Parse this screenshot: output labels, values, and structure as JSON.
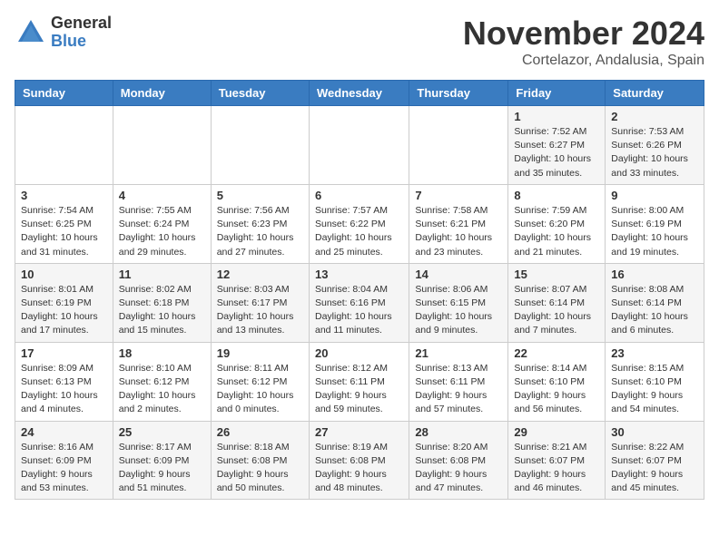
{
  "logo": {
    "general": "General",
    "blue": "Blue"
  },
  "title": "November 2024",
  "location": "Cortelazor, Andalusia, Spain",
  "days_of_week": [
    "Sunday",
    "Monday",
    "Tuesday",
    "Wednesday",
    "Thursday",
    "Friday",
    "Saturday"
  ],
  "weeks": [
    [
      {
        "day": "",
        "info": ""
      },
      {
        "day": "",
        "info": ""
      },
      {
        "day": "",
        "info": ""
      },
      {
        "day": "",
        "info": ""
      },
      {
        "day": "",
        "info": ""
      },
      {
        "day": "1",
        "info": "Sunrise: 7:52 AM\nSunset: 6:27 PM\nDaylight: 10 hours and 35 minutes."
      },
      {
        "day": "2",
        "info": "Sunrise: 7:53 AM\nSunset: 6:26 PM\nDaylight: 10 hours and 33 minutes."
      }
    ],
    [
      {
        "day": "3",
        "info": "Sunrise: 7:54 AM\nSunset: 6:25 PM\nDaylight: 10 hours and 31 minutes."
      },
      {
        "day": "4",
        "info": "Sunrise: 7:55 AM\nSunset: 6:24 PM\nDaylight: 10 hours and 29 minutes."
      },
      {
        "day": "5",
        "info": "Sunrise: 7:56 AM\nSunset: 6:23 PM\nDaylight: 10 hours and 27 minutes."
      },
      {
        "day": "6",
        "info": "Sunrise: 7:57 AM\nSunset: 6:22 PM\nDaylight: 10 hours and 25 minutes."
      },
      {
        "day": "7",
        "info": "Sunrise: 7:58 AM\nSunset: 6:21 PM\nDaylight: 10 hours and 23 minutes."
      },
      {
        "day": "8",
        "info": "Sunrise: 7:59 AM\nSunset: 6:20 PM\nDaylight: 10 hours and 21 minutes."
      },
      {
        "day": "9",
        "info": "Sunrise: 8:00 AM\nSunset: 6:19 PM\nDaylight: 10 hours and 19 minutes."
      }
    ],
    [
      {
        "day": "10",
        "info": "Sunrise: 8:01 AM\nSunset: 6:19 PM\nDaylight: 10 hours and 17 minutes."
      },
      {
        "day": "11",
        "info": "Sunrise: 8:02 AM\nSunset: 6:18 PM\nDaylight: 10 hours and 15 minutes."
      },
      {
        "day": "12",
        "info": "Sunrise: 8:03 AM\nSunset: 6:17 PM\nDaylight: 10 hours and 13 minutes."
      },
      {
        "day": "13",
        "info": "Sunrise: 8:04 AM\nSunset: 6:16 PM\nDaylight: 10 hours and 11 minutes."
      },
      {
        "day": "14",
        "info": "Sunrise: 8:06 AM\nSunset: 6:15 PM\nDaylight: 10 hours and 9 minutes."
      },
      {
        "day": "15",
        "info": "Sunrise: 8:07 AM\nSunset: 6:14 PM\nDaylight: 10 hours and 7 minutes."
      },
      {
        "day": "16",
        "info": "Sunrise: 8:08 AM\nSunset: 6:14 PM\nDaylight: 10 hours and 6 minutes."
      }
    ],
    [
      {
        "day": "17",
        "info": "Sunrise: 8:09 AM\nSunset: 6:13 PM\nDaylight: 10 hours and 4 minutes."
      },
      {
        "day": "18",
        "info": "Sunrise: 8:10 AM\nSunset: 6:12 PM\nDaylight: 10 hours and 2 minutes."
      },
      {
        "day": "19",
        "info": "Sunrise: 8:11 AM\nSunset: 6:12 PM\nDaylight: 10 hours and 0 minutes."
      },
      {
        "day": "20",
        "info": "Sunrise: 8:12 AM\nSunset: 6:11 PM\nDaylight: 9 hours and 59 minutes."
      },
      {
        "day": "21",
        "info": "Sunrise: 8:13 AM\nSunset: 6:11 PM\nDaylight: 9 hours and 57 minutes."
      },
      {
        "day": "22",
        "info": "Sunrise: 8:14 AM\nSunset: 6:10 PM\nDaylight: 9 hours and 56 minutes."
      },
      {
        "day": "23",
        "info": "Sunrise: 8:15 AM\nSunset: 6:10 PM\nDaylight: 9 hours and 54 minutes."
      }
    ],
    [
      {
        "day": "24",
        "info": "Sunrise: 8:16 AM\nSunset: 6:09 PM\nDaylight: 9 hours and 53 minutes."
      },
      {
        "day": "25",
        "info": "Sunrise: 8:17 AM\nSunset: 6:09 PM\nDaylight: 9 hours and 51 minutes."
      },
      {
        "day": "26",
        "info": "Sunrise: 8:18 AM\nSunset: 6:08 PM\nDaylight: 9 hours and 50 minutes."
      },
      {
        "day": "27",
        "info": "Sunrise: 8:19 AM\nSunset: 6:08 PM\nDaylight: 9 hours and 48 minutes."
      },
      {
        "day": "28",
        "info": "Sunrise: 8:20 AM\nSunset: 6:08 PM\nDaylight: 9 hours and 47 minutes."
      },
      {
        "day": "29",
        "info": "Sunrise: 8:21 AM\nSunset: 6:07 PM\nDaylight: 9 hours and 46 minutes."
      },
      {
        "day": "30",
        "info": "Sunrise: 8:22 AM\nSunset: 6:07 PM\nDaylight: 9 hours and 45 minutes."
      }
    ]
  ]
}
